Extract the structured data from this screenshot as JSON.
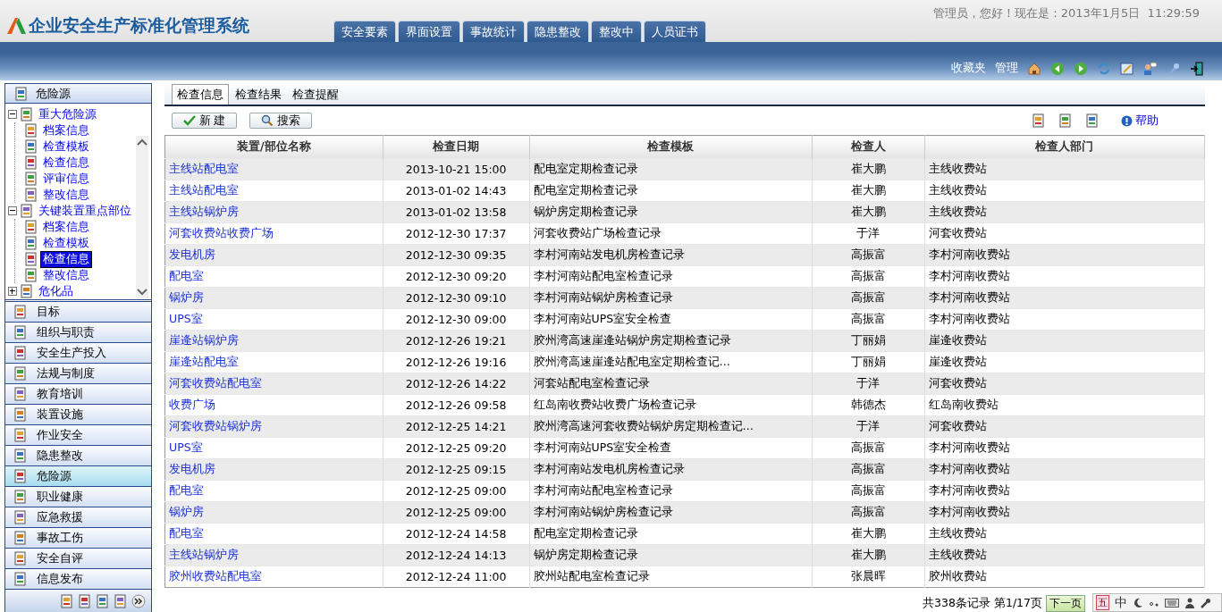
{
  "header": {
    "title": "企业安全生产标准化管理系统",
    "greeting": "管理员，您好！现在是：2013年1月5日  11:29:59",
    "nav_tabs": [
      "安全要素",
      "界面设置",
      "事故统计",
      "隐患整改",
      "整改中",
      "人员证书"
    ],
    "links": [
      "收藏夹",
      "管理"
    ]
  },
  "sidebar": {
    "panel_title": "危险源",
    "tree": [
      {
        "label": "重大危险源",
        "expanded": true,
        "children": [
          {
            "label": "档案信息",
            "selected": false
          },
          {
            "label": "检查模板",
            "selected": false
          },
          {
            "label": "检查信息",
            "selected": false
          },
          {
            "label": "评审信息",
            "selected": false
          },
          {
            "label": "整改信息",
            "selected": false
          }
        ]
      },
      {
        "label": "关键装置重点部位",
        "expanded": true,
        "children": [
          {
            "label": "档案信息",
            "selected": false
          },
          {
            "label": "检查模板",
            "selected": false
          },
          {
            "label": "检查信息",
            "selected": true
          },
          {
            "label": "整改信息",
            "selected": false
          }
        ]
      },
      {
        "label": "危化品",
        "expanded": false
      }
    ],
    "modules": [
      {
        "label": "目标",
        "selected": false
      },
      {
        "label": "组织与职责",
        "selected": false
      },
      {
        "label": "安全生产投入",
        "selected": false
      },
      {
        "label": "法规与制度",
        "selected": false
      },
      {
        "label": "教育培训",
        "selected": false
      },
      {
        "label": "装置设施",
        "selected": false
      },
      {
        "label": "作业安全",
        "selected": false
      },
      {
        "label": "隐患整改",
        "selected": false
      },
      {
        "label": "危险源",
        "selected": true
      },
      {
        "label": "职业健康",
        "selected": false
      },
      {
        "label": "应急救援",
        "selected": false
      },
      {
        "label": "事故工伤",
        "selected": false
      },
      {
        "label": "安全自评",
        "selected": false
      },
      {
        "label": "信息发布",
        "selected": false
      }
    ]
  },
  "main": {
    "tabs": [
      {
        "label": "检查信息",
        "selected": true
      },
      {
        "label": "检查结果",
        "selected": false
      },
      {
        "label": "检查提醒",
        "selected": false
      }
    ],
    "buttons": [
      "新 建",
      "搜索"
    ],
    "help": "帮助",
    "table": {
      "columns": [
        "装置/部位名称",
        "检查日期",
        "检查模板",
        "检查人",
        "检查人部门"
      ],
      "rows": [
        [
          "主线站配电室",
          "2013-10-21 15:00",
          "配电室定期检查记录",
          "崔大鹏",
          "主线收费站"
        ],
        [
          "主线站配电室",
          "2013-01-02 14:43",
          "配电室定期检查记录",
          "崔大鹏",
          "主线收费站"
        ],
        [
          "主线站锅炉房",
          "2013-01-02 13:58",
          "锅炉房定期检查记录",
          "崔大鹏",
          "主线收费站"
        ],
        [
          "河套收费站收费广场",
          "2012-12-30 17:37",
          "河套收费站广场检查记录",
          "于洋",
          "河套收费站"
        ],
        [
          "发电机房",
          "2012-12-30 09:35",
          "李村河南站发电机房检查记录",
          "高振富",
          "李村河南收费站"
        ],
        [
          "配电室",
          "2012-12-30 09:20",
          "李村河南站配电室检查记录",
          "高振富",
          "李村河南收费站"
        ],
        [
          "锅炉房",
          "2012-12-30 09:10",
          "李村河南站锅炉房检查记录",
          "高振富",
          "李村河南收费站"
        ],
        [
          "UPS室",
          "2012-12-30 09:00",
          "李村河南站UPS室安全检查",
          "高振富",
          "李村河南收费站"
        ],
        [
          "崖逄站锅炉房",
          "2012-12-26 19:21",
          "胶州湾高速崖逄站锅炉房定期检查记录",
          "丁丽娟",
          "崖逄收费站"
        ],
        [
          "崖逄站配电室",
          "2012-12-26 19:16",
          "胶州湾高速崖逄站配电室定期检查记…",
          "丁丽娟",
          "崖逄收费站"
        ],
        [
          "河套收费站配电室",
          "2012-12-26 14:22",
          "河套站配电室检查记录",
          "于洋",
          "河套收费站"
        ],
        [
          "收费广场",
          "2012-12-26 09:58",
          "红岛南收费站收费广场检查记录",
          "韩德杰",
          "红岛南收费站"
        ],
        [
          "河套收费站锅炉房",
          "2012-12-25 14:21",
          "胶州湾高速河套收费站锅炉房定期检查记…",
          "于洋",
          "河套收费站"
        ],
        [
          "UPS室",
          "2012-12-25 09:20",
          "李村河南站UPS室安全检查",
          "高振富",
          "李村河南收费站"
        ],
        [
          "发电机房",
          "2012-12-25 09:15",
          "李村河南站发电机房检查记录",
          "高振富",
          "李村河南收费站"
        ],
        [
          "配电室",
          "2012-12-25 09:00",
          "李村河南站配电室检查记录",
          "高振富",
          "李村河南收费站"
        ],
        [
          "锅炉房",
          "2012-12-25 09:00",
          "李村河南站锅炉房检查记录",
          "高振富",
          "李村河南收费站"
        ],
        [
          "配电室",
          "2012-12-24 14:58",
          "配电室定期检查记录",
          "崔大鹏",
          "主线收费站"
        ],
        [
          "主线站锅炉房",
          "2012-12-24 14:13",
          "锅炉房定期检查记录",
          "崔大鹏",
          "主线收费站"
        ],
        [
          "胶州收费站配电室",
          "2012-12-24 11:00",
          "胶州站配电室检查记录",
          "张晨晖",
          "胶州收费站"
        ]
      ]
    },
    "pagination": {
      "summary": "共338条记录 第1/17页",
      "next": "下一页"
    }
  },
  "ime_bar": {
    "labels": [
      "五",
      "中"
    ]
  }
}
